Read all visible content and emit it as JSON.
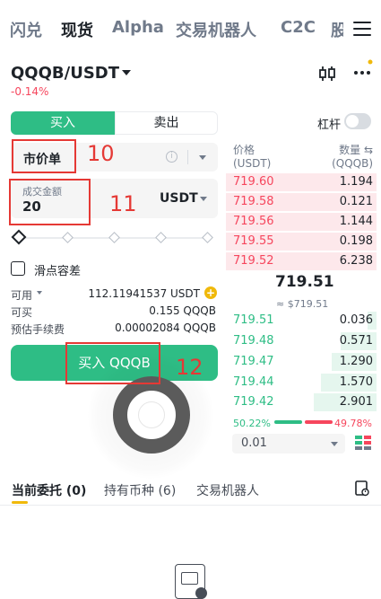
{
  "nav": {
    "tabs": [
      "闪兑",
      "现货",
      "Alpha",
      "交易机器人",
      "C2C",
      "股"
    ],
    "active_index": 1,
    "menu_icon": "hamburger-menu-icon"
  },
  "pair": {
    "symbol": "QQQB/USDT",
    "change": "-0.14%",
    "chart_icon": "candlestick-chart-icon",
    "more_icon": "more-dots-icon"
  },
  "order_form": {
    "buy_label": "买入",
    "sell_label": "卖出",
    "order_type": "市价单",
    "amount_label": "成交金额",
    "amount_value": "20",
    "quote_currency": "USDT",
    "slippage_label": "滑点容差",
    "available_label": "可用",
    "available_value": "112.11941537 USDT",
    "can_buy_label": "可买",
    "can_buy_value": "0.155 QQQB",
    "fee_label": "预估手续费",
    "fee_value": "0.00002084 QQQB",
    "submit_label": "买入 QQQB",
    "slider_percent": 0
  },
  "annotations": [
    "10",
    "11",
    "12"
  ],
  "orderbook": {
    "leverage_label": "杠杆",
    "price_header": "价格",
    "price_unit": "(USDT)",
    "qty_header": "数量",
    "qty_unit": "(QQQB)",
    "asks": [
      {
        "price": "719.60",
        "qty": "1.194"
      },
      {
        "price": "719.58",
        "qty": "0.121"
      },
      {
        "price": "719.56",
        "qty": "1.144"
      },
      {
        "price": "719.55",
        "qty": "0.198"
      },
      {
        "price": "719.52",
        "qty": "6.238"
      }
    ],
    "last_price": "719.51",
    "last_price_fiat": "≈ $719.51",
    "bids": [
      {
        "price": "719.51",
        "qty": "0.036"
      },
      {
        "price": "719.48",
        "qty": "0.571"
      },
      {
        "price": "719.47",
        "qty": "1.290"
      },
      {
        "price": "719.44",
        "qty": "1.570"
      },
      {
        "price": "719.42",
        "qty": "2.901"
      }
    ],
    "buy_ratio": "50.22%",
    "sell_ratio": "49.78%",
    "precision": "0.01"
  },
  "bottom_tabs": {
    "items": [
      "当前委托 (0)",
      "持有币种 (6)",
      "交易机器人"
    ],
    "active_index": 0
  },
  "colors": {
    "buy": "#2ebd85",
    "sell": "#f6465d",
    "accent": "#f0b90b",
    "annotation": "#e53935"
  }
}
